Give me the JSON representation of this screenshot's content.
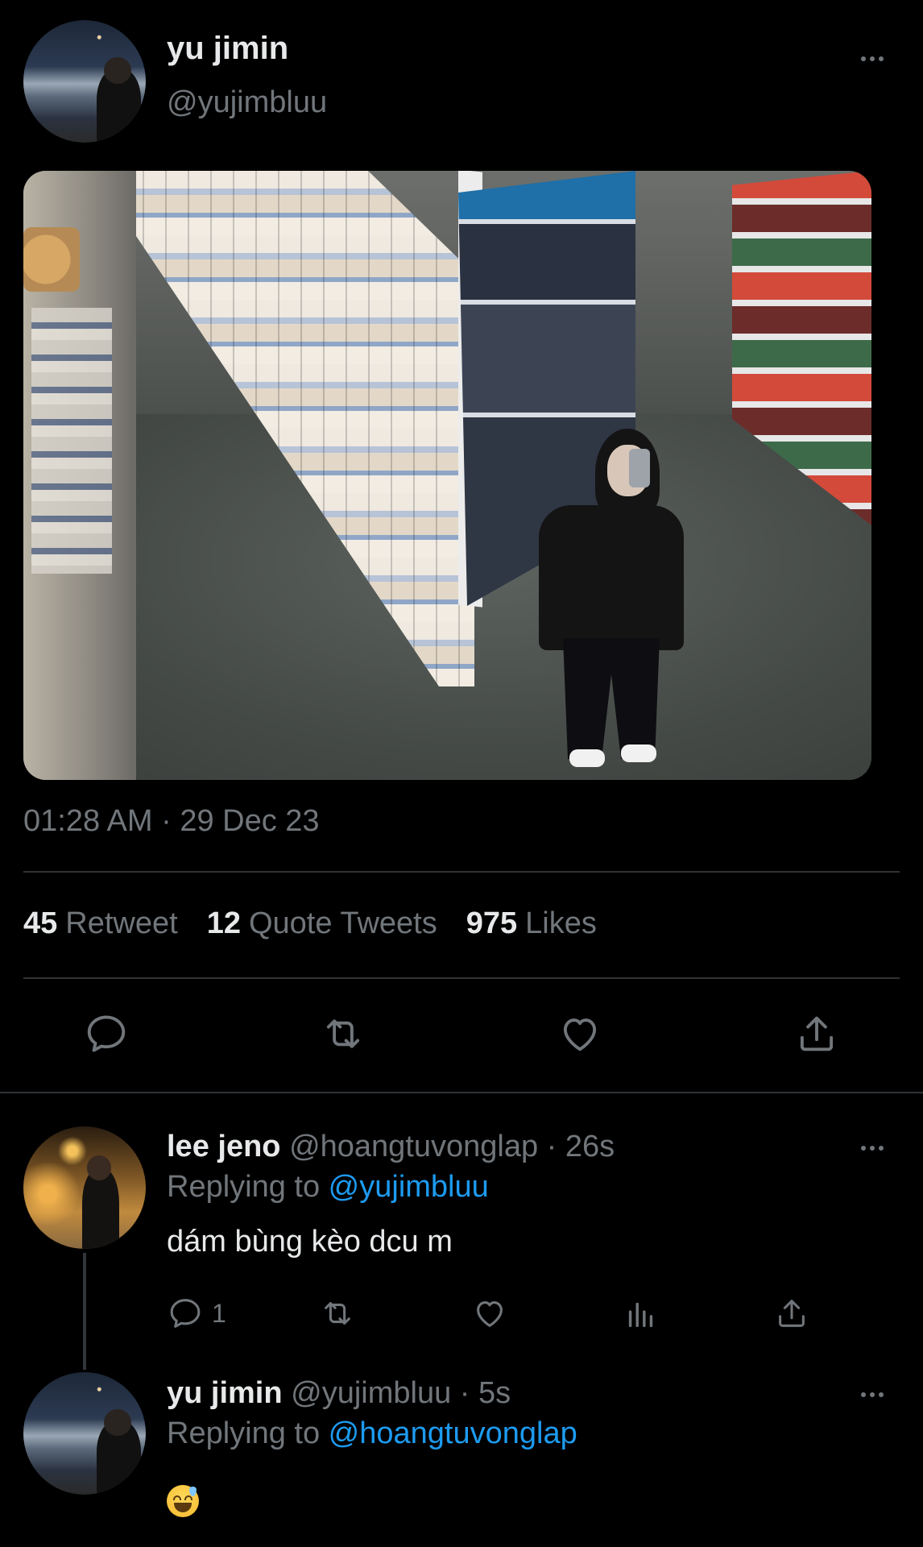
{
  "tweet": {
    "author": {
      "name": "yu jimin",
      "handle": "@yujimbluu"
    },
    "timestamp": "01:28 AM · 29 Dec 23",
    "stats": {
      "retweets": {
        "count": "45",
        "label": "Retweet"
      },
      "quotes": {
        "count": "12",
        "label": "Quote Tweets"
      },
      "likes": {
        "count": "975",
        "label": "Likes"
      }
    },
    "actions": {
      "reply_icon": "comment-icon",
      "retweet_icon": "retweet-icon",
      "like_icon": "heart-icon",
      "share_icon": "share-icon"
    }
  },
  "replies": [
    {
      "name": "lee jeno",
      "handle": "@hoangtuvonglap",
      "time": "· 26s",
      "replying_prefix": "Replying to ",
      "replying_to": "@yujimbluu",
      "text": "dám bùng kèo dcu m",
      "reply_count": "1"
    },
    {
      "name": "yu jimin",
      "handle": "@yujimbluu",
      "time": "· 5s",
      "replying_prefix": "Replying to ",
      "replying_to": "@hoangtuvonglap",
      "text": "😅"
    }
  ],
  "colors": {
    "background": "#000000",
    "text": "#e7e9ea",
    "muted": "#71767b",
    "link": "#1d9bf0",
    "divider": "#2f3336"
  }
}
